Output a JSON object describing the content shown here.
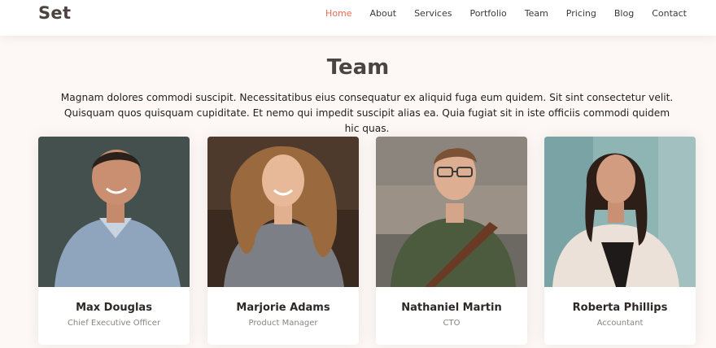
{
  "brand": {
    "logo": "Set"
  },
  "nav": {
    "items": [
      {
        "label": "Home",
        "active": true
      },
      {
        "label": "About",
        "active": false
      },
      {
        "label": "Services",
        "active": false
      },
      {
        "label": "Portfolio",
        "active": false
      },
      {
        "label": "Team",
        "active": false
      },
      {
        "label": "Pricing",
        "active": false
      },
      {
        "label": "Blog",
        "active": false
      },
      {
        "label": "Contact",
        "active": false
      }
    ]
  },
  "team": {
    "title": "Team",
    "description": "Magnam dolores commodi suscipit. Necessitatibus eius consequatur ex aliquid fuga eum quidem. Sit sint consectetur velit. Quisquam quos quisquam cupiditate. Et nemo qui impedit suscipit alias ea. Quia fugiat sit in iste officiis commodi quidem hic quas.",
    "members": [
      {
        "name": "Max Douglas",
        "role": "Chief Executive Officer"
      },
      {
        "name": "Marjorie Adams",
        "role": "Product Manager"
      },
      {
        "name": "Nathaniel Martin",
        "role": "CTO"
      },
      {
        "name": "Roberta Phillips",
        "role": "Accountant"
      }
    ]
  },
  "colors": {
    "accent": "#e96b56",
    "background": "#fdf8f6",
    "text": "#4a4442"
  }
}
